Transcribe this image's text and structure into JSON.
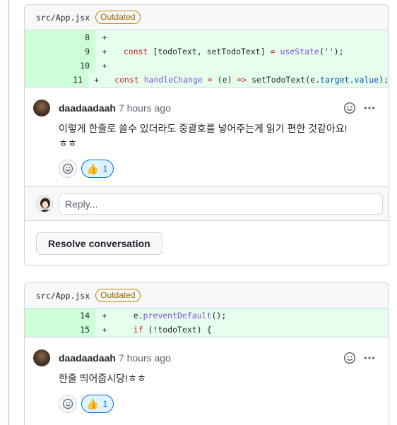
{
  "threads": [
    {
      "file": "src/App.jsx",
      "badge": "Outdated",
      "diff": [
        {
          "line": "8",
          "sign": "+",
          "tokens": []
        },
        {
          "line": "9",
          "sign": "+",
          "tokens": [
            {
              "t": "  ",
              "c": ""
            },
            {
              "t": "const",
              "c": "kw"
            },
            {
              "t": " [todoText, setTodoText] ",
              "c": ""
            },
            {
              "t": "=",
              "c": "kw"
            },
            {
              "t": " ",
              "c": ""
            },
            {
              "t": "useState",
              "c": "fn"
            },
            {
              "t": "(",
              "c": ""
            },
            {
              "t": "''",
              "c": "str"
            },
            {
              "t": ");",
              "c": ""
            }
          ]
        },
        {
          "line": "10",
          "sign": "+",
          "tokens": []
        },
        {
          "line": "11",
          "sign": "+",
          "tokens": [
            {
              "t": "  ",
              "c": ""
            },
            {
              "t": "const",
              "c": "kw"
            },
            {
              "t": " ",
              "c": ""
            },
            {
              "t": "handleChange",
              "c": "fn"
            },
            {
              "t": " ",
              "c": ""
            },
            {
              "t": "=",
              "c": "kw"
            },
            {
              "t": " (e) ",
              "c": ""
            },
            {
              "t": "=>",
              "c": "kw"
            },
            {
              "t": " setTodoText(e.",
              "c": ""
            },
            {
              "t": "target",
              "c": "prop"
            },
            {
              "t": ".",
              "c": ""
            },
            {
              "t": "value",
              "c": "prop"
            },
            {
              "t": ");",
              "c": ""
            }
          ]
        }
      ],
      "comment": {
        "author": "daadaadaah",
        "time": "7 hours ago",
        "body_line1": "이렇게 한줄로 쓸수 있더라도 중괄호를 넣어주는게 읽기 편한 것같아요!",
        "body_line2": "ㅎㅎ",
        "reaction_emoji": "👍",
        "reaction_count": "1"
      },
      "reply_placeholder": "Reply...",
      "resolve_label": "Resolve conversation"
    },
    {
      "file": "src/App.jsx",
      "badge": "Outdated",
      "diff": [
        {
          "line": "14",
          "sign": "+",
          "tokens": [
            {
              "t": "    e.",
              "c": ""
            },
            {
              "t": "preventDefault",
              "c": "fn"
            },
            {
              "t": "();",
              "c": ""
            }
          ]
        },
        {
          "line": "15",
          "sign": "+",
          "tokens": [
            {
              "t": "    ",
              "c": ""
            },
            {
              "t": "if",
              "c": "kw"
            },
            {
              "t": " (!todoText) {",
              "c": ""
            }
          ]
        }
      ],
      "comment": {
        "author": "daadaadaah",
        "time": "7 hours ago",
        "body_line1": "한줄 띄어줍시당!ㅎㅎ",
        "reaction_emoji": "👍",
        "reaction_count": "1"
      }
    }
  ],
  "icons": {
    "smiley": "smiley-icon",
    "kebab": "kebab-horizontal-icon",
    "thumbs_up": "thumbs-up-icon"
  }
}
